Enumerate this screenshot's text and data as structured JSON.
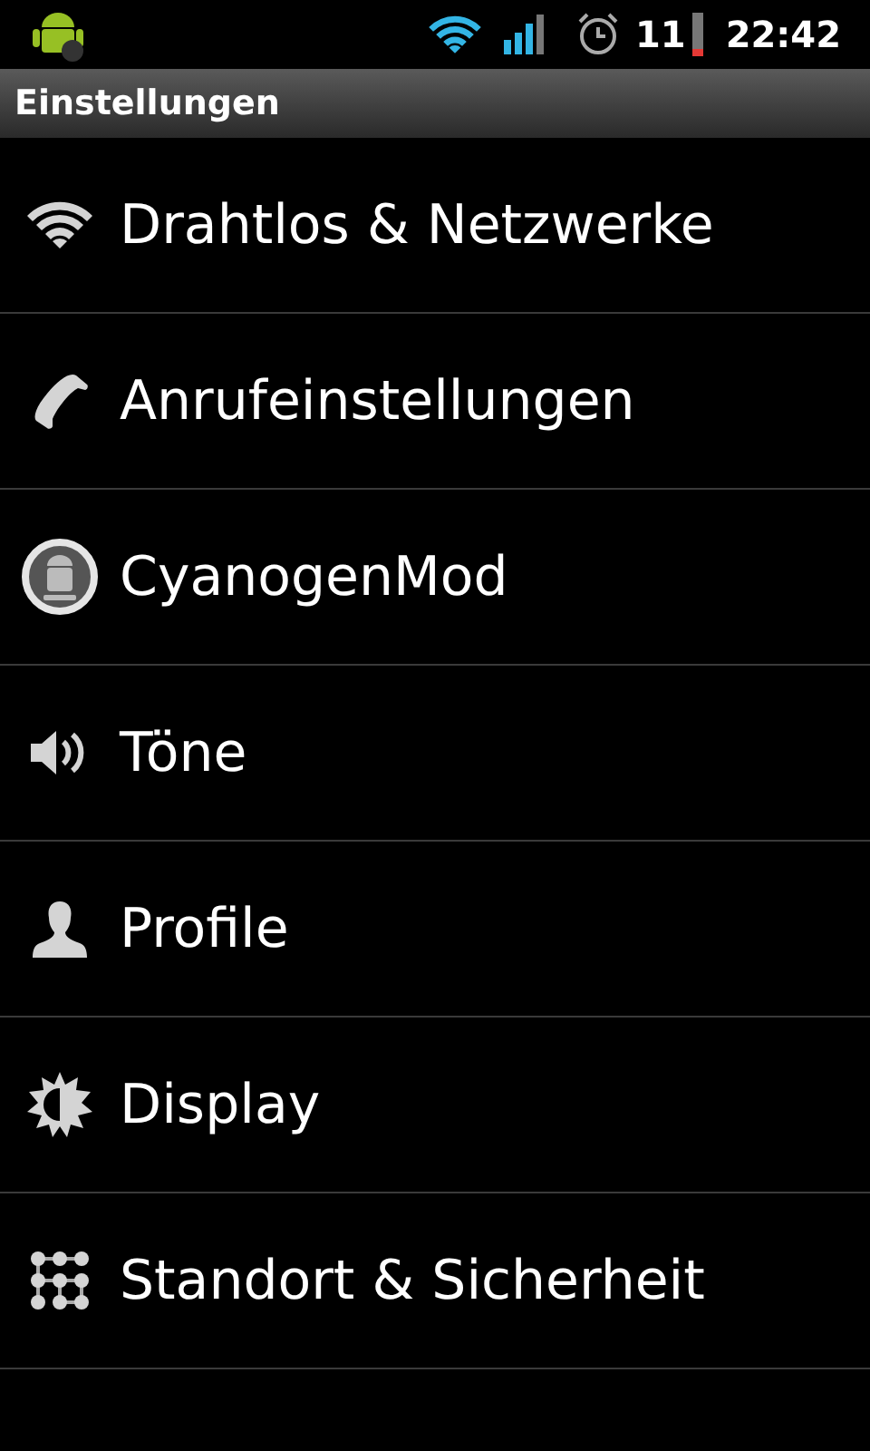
{
  "status_bar": {
    "battery_percent": "11",
    "time": "22:42"
  },
  "title": "Einstellungen",
  "items": [
    {
      "label": "Drahtlos & Netzwerke",
      "kind": "wifi"
    },
    {
      "label": "Anrufeinstellungen",
      "kind": "phone"
    },
    {
      "label": "CyanogenMod",
      "kind": "mod"
    },
    {
      "label": "Töne",
      "kind": "sound"
    },
    {
      "label": "Profile",
      "kind": "profile"
    },
    {
      "label": "Display",
      "kind": "display"
    },
    {
      "label": "Standort & Sicherheit",
      "kind": "location"
    }
  ]
}
